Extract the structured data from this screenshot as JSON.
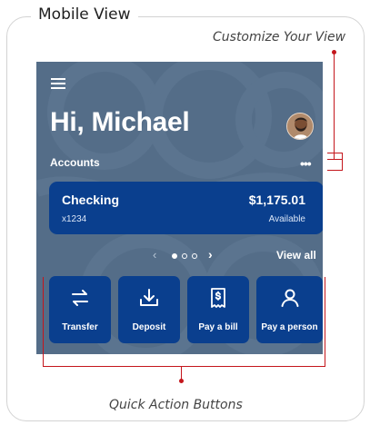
{
  "frame": {
    "title": "Mobile View"
  },
  "callouts": {
    "top": "Customize Your View",
    "bottom": "Quick Action Buttons"
  },
  "app": {
    "greeting": "Hi, Michael",
    "accounts_label": "Accounts",
    "more_icon": "•••",
    "account": {
      "name": "Checking",
      "number": "x1234",
      "balance": "$1,175.01",
      "balance_label": "Available"
    },
    "pager": {
      "prev": "‹",
      "next": "›",
      "view_all": "View all",
      "current": 1,
      "total": 3
    },
    "actions": [
      {
        "label": "Transfer",
        "icon": "transfer-icon"
      },
      {
        "label": "Deposit",
        "icon": "deposit-icon"
      },
      {
        "label": "Pay a bill",
        "icon": "bill-icon"
      },
      {
        "label": "Pay a person",
        "icon": "person-icon"
      }
    ]
  },
  "colors": {
    "background": "#546d88",
    "card": "#0a3f8e",
    "callout": "#c4161c"
  }
}
